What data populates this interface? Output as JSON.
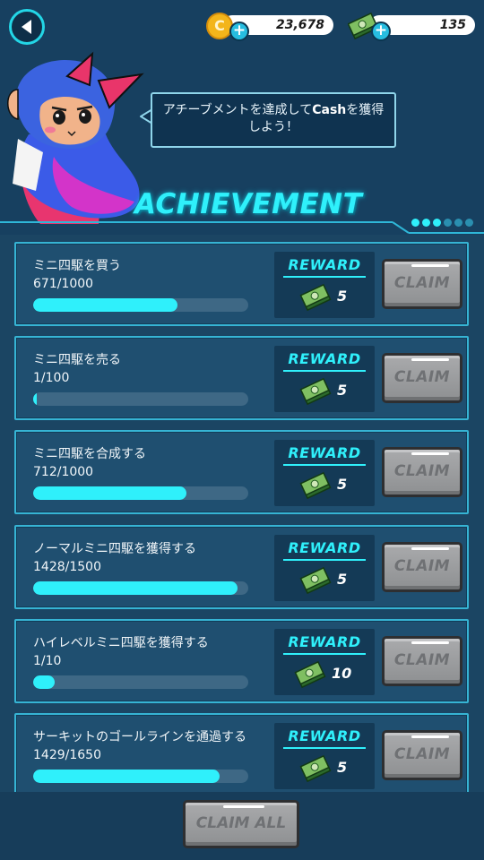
{
  "header": {
    "coins": "23,678",
    "cash": "135",
    "coin_symbol": "C",
    "plus_symbol": "+",
    "speech_prefix": "アチーブメントを達成して",
    "speech_bold": "Cash",
    "speech_suffix": "を獲得しよう！",
    "title": "ACHIEVEMENT",
    "page_dots": [
      true,
      true,
      true,
      false,
      false,
      false
    ]
  },
  "reward_label": "REWARD",
  "claim_label": "CLAIM",
  "achievements": [
    {
      "name": "ミニ四駆を買う",
      "progress_text": "671/1000",
      "progress": 0.671,
      "reward": "5"
    },
    {
      "name": "ミニ四駆を売る",
      "progress_text": "1/100",
      "progress": 0.01,
      "reward": "5"
    },
    {
      "name": "ミニ四駆を合成する",
      "progress_text": "712/1000",
      "progress": 0.712,
      "reward": "5"
    },
    {
      "name": "ノーマルミニ四駆を獲得する",
      "progress_text": "1428/1500",
      "progress": 0.952,
      "reward": "5"
    },
    {
      "name": "ハイレベルミニ四駆を獲得する",
      "progress_text": "1/10",
      "progress": 0.1,
      "reward": "10"
    },
    {
      "name": "サーキットのゴールラインを通過する",
      "progress_text": "1429/1650",
      "progress": 0.866,
      "reward": "5"
    }
  ],
  "footer": {
    "claim_all_label": "CLAIM ALL"
  },
  "colors": {
    "accent": "#2ff0fb",
    "panel": "#1f4f70",
    "button_gray": "#9c9ea0"
  }
}
